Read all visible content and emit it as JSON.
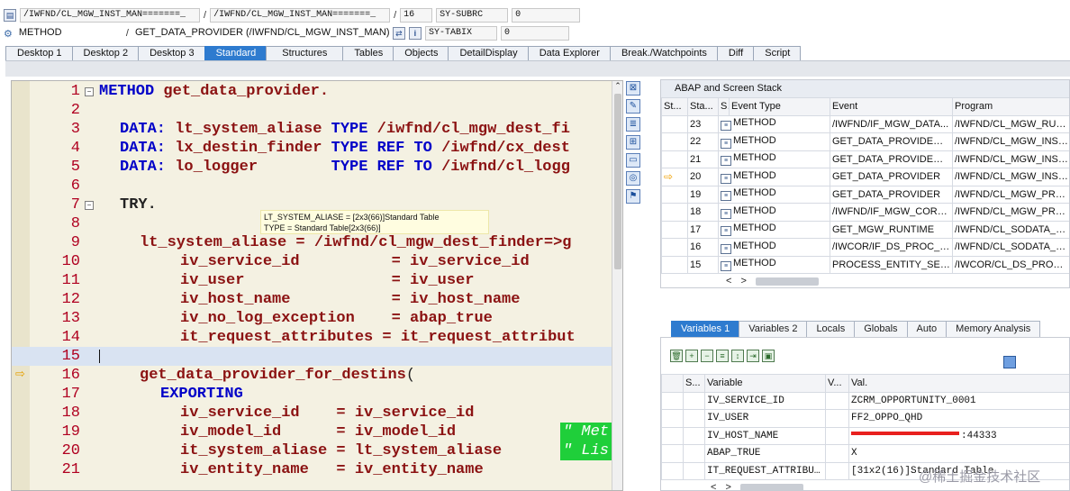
{
  "header": {
    "row1": {
      "path1": "/IWFND/CL_MGW_INST_MAN=======_",
      "path2": "/IWFND/CL_MGW_INST_MAN=======_",
      "line": "16",
      "var_name": "SY-SUBRC",
      "var_value": "0"
    },
    "row2": {
      "type": "METHOD",
      "method": "GET_DATA_PROVIDER (/IWFND/CL_MGW_INST_MAN)",
      "var_name": "SY-TABIX",
      "var_value": "0"
    }
  },
  "tabs": [
    "Desktop 1",
    "Desktop 2",
    "Desktop 3",
    "Standard",
    "Structures",
    "Tables",
    "Objects",
    "DetailDisplay",
    "Data Explorer",
    "Break./Watchpoints",
    "Diff",
    "Script"
  ],
  "active_tab": "Standard",
  "code": {
    "line_numbers": [
      "1",
      "2",
      "3",
      "4",
      "5",
      "6",
      "7",
      "8",
      "9",
      "10",
      "11",
      "12",
      "13",
      "14",
      "15",
      "16",
      "17",
      "18",
      "19",
      "20",
      "21"
    ],
    "current_line": "16",
    "tooltip": {
      "line1": "LT_SYSTEM_ALIASE = [2x3(66)]Standard Table",
      "line2": "TYPE = Standard Table[2x3(66)]"
    },
    "comment19": "\" Met",
    "comment20": "\" Lis"
  },
  "stack": {
    "title": "ABAP and Screen Stack",
    "columns": [
      "St...",
      "Sta...",
      "S...",
      "Event Type",
      "Event",
      "Program"
    ],
    "rows": [
      {
        "sta": "23",
        "type": "METHOD",
        "event": "/IWFND/IF_MGW_DATA...",
        "program": "/IWFND/CL_MGW_RUNT..."
      },
      {
        "sta": "22",
        "type": "METHOD",
        "event": "GET_DATA_PROVIDER_...",
        "program": "/IWFND/CL_MGW_INST_..."
      },
      {
        "sta": "21",
        "type": "METHOD",
        "event": "GET_DATA_PROVIDER_...",
        "program": "/IWFND/CL_MGW_INST_..."
      },
      {
        "sta": "20",
        "type": "METHOD",
        "event": "GET_DATA_PROVIDER",
        "program": "/IWFND/CL_MGW_INST_..."
      },
      {
        "sta": "19",
        "type": "METHOD",
        "event": "GET_DATA_PROVIDER",
        "program": "/IWFND/CL_MGW_PROV..."
      },
      {
        "sta": "18",
        "type": "METHOD",
        "event": "/IWFND/IF_MGW_CORE_...",
        "program": "/IWFND/CL_MGW_PROV..."
      },
      {
        "sta": "17",
        "type": "METHOD",
        "event": "GET_MGW_RUNTIME",
        "program": "/IWFND/CL_SODATA_PR..."
      },
      {
        "sta": "16",
        "type": "METHOD",
        "event": "/IWCOR/IF_DS_PROC_E...",
        "program": "/IWFND/CL_SODATA_PR..."
      },
      {
        "sta": "15",
        "type": "METHOD",
        "event": "PROCESS_ENTITY_SET_...",
        "program": "/IWCOR/CL_DS_PROC_D..."
      }
    ]
  },
  "variables": {
    "tabs": [
      "Variables 1",
      "Variables 2",
      "Locals",
      "Globals",
      "Auto",
      "Memory Analysis"
    ],
    "columns": [
      "S...",
      "Variable",
      "V...",
      "Val."
    ],
    "rows": [
      {
        "name": "IV_SERVICE_ID",
        "value": "ZCRM_OPPORTUNITY_0001"
      },
      {
        "name": "IV_USER",
        "value": "FF2_OPPO_QHD"
      },
      {
        "name": "IV_HOST_NAME",
        "value": ":44333"
      },
      {
        "name": "ABAP_TRUE",
        "value": "X"
      },
      {
        "name": "IT_REQUEST_ATTRIBUT...",
        "value": "[31x2(16)]Standard Table"
      }
    ]
  },
  "watermark": "@稀土掘金技术社区"
}
